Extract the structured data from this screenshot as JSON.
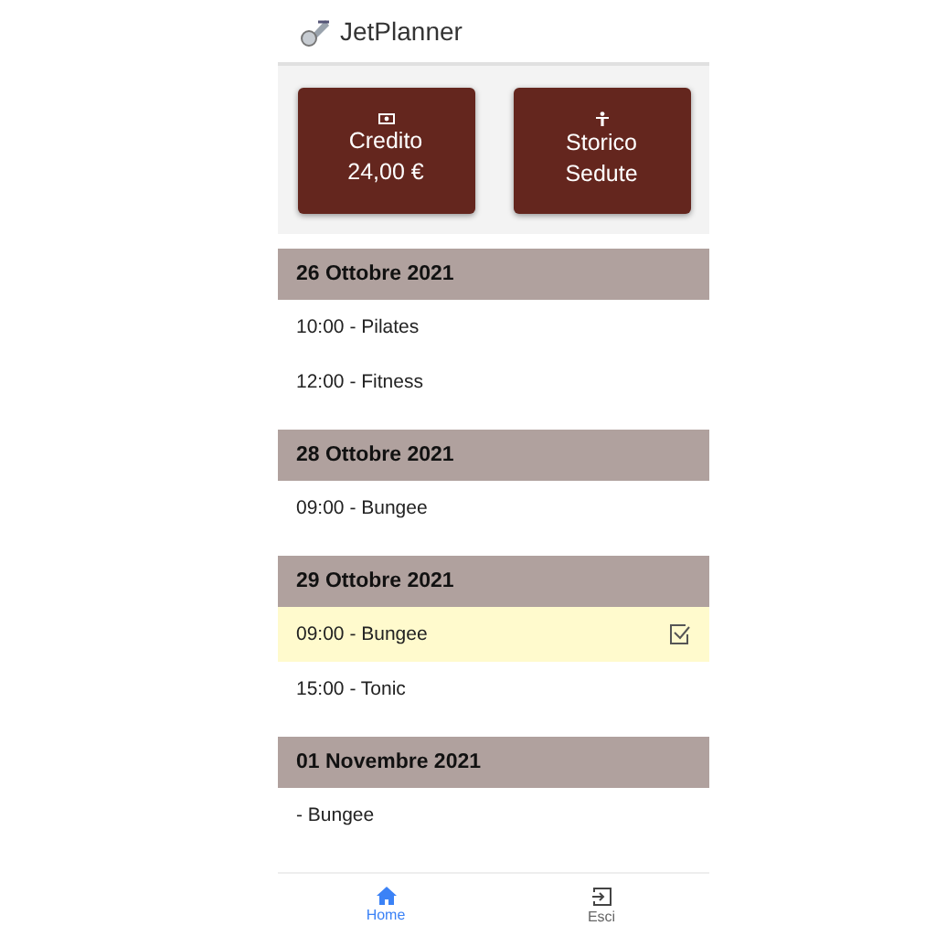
{
  "app_bar": {
    "title": "JetPlanner"
  },
  "tiles": [
    {
      "kind": "cash",
      "lines": [
        "Credito",
        "24,00 €"
      ]
    },
    {
      "kind": "person",
      "lines": [
        "Storico",
        "Sedute"
      ]
    }
  ],
  "days": [
    {
      "date": "26 Ottobre 2021",
      "sessions": [
        {
          "label": "10:00 - Pilates",
          "selected": false
        },
        {
          "label": "12:00 - Fitness",
          "selected": false
        }
      ]
    },
    {
      "date": "28 Ottobre 2021",
      "sessions": [
        {
          "label": "09:00 - Bungee",
          "selected": false
        }
      ]
    },
    {
      "date": "29 Ottobre 2021",
      "sessions": [
        {
          "label": "09:00 - Bungee",
          "selected": true
        },
        {
          "label": "15:00 - Tonic",
          "selected": false
        }
      ]
    },
    {
      "date": "01 Novembre 2021",
      "sessions": [
        {
          "label": "- Bungee",
          "selected": false
        }
      ]
    }
  ],
  "bottom_nav": [
    {
      "kind": "home",
      "label": "Home",
      "selected": true
    },
    {
      "kind": "exit",
      "label": "Esci",
      "selected": false
    }
  ]
}
